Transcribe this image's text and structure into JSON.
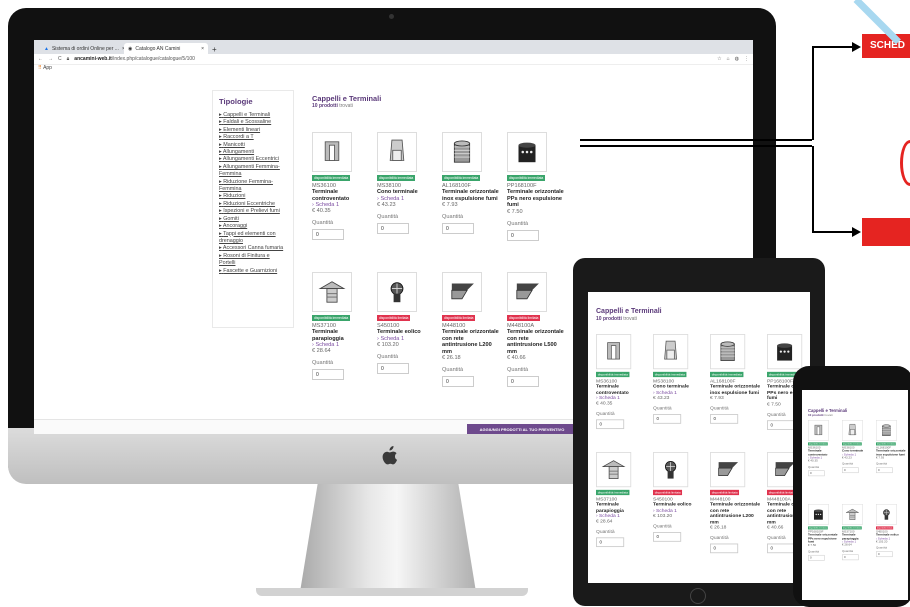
{
  "browser": {
    "tabs": [
      {
        "label": "Sistema di ordini Online per ...",
        "active": false
      },
      {
        "label": "Catalogo AN Camini",
        "active": true
      }
    ],
    "new_tab": "+",
    "url_host": "ancamini-web.it",
    "url_path": "/index.php/catalogue/catalogue/5/100",
    "bookmarks_label": "App"
  },
  "sidebar": {
    "title": "Tipologie",
    "items": [
      "Cappelli e Terminali",
      "Faldali e Scossaline",
      "Elementi lineari",
      "Raccordi a T",
      "Manicotti",
      "Allungamenti",
      "Allungamenti Eccentrici",
      "Allungamenti Femmina-Femmina",
      "Riduzione Femmina-Femmina",
      "Riduzioni",
      "Riduzioni Eccentriche",
      "Ispezioni e Prelievi fumi",
      "Gomiti",
      "Ancoraggi",
      "Tappi ed elementi con drenaggio",
      "Accessori Canna fumaria",
      "Rosoni di Finitura e Portelli",
      "Fascette e Guarnizioni"
    ]
  },
  "main": {
    "title": "Cappelli e Terminali",
    "count": "10 prodotti",
    "count_suffix": "trovati",
    "quantity_label": "Quantità",
    "cta": "AGGIUNGI PRODOTTI AL TUO PREVENTIVO"
  },
  "products": [
    {
      "badge": "disponibilità immediata",
      "badge_color": "#3aa56b",
      "code": "MS36100",
      "name": "Terminale controventato",
      "link": "Scheda 1",
      "price": "€ 40.35",
      "qty": "0"
    },
    {
      "badge": "disponibilità immediata",
      "badge_color": "#3aa56b",
      "code": "MS38100",
      "name": "Cono terminale",
      "link": "Scheda 1",
      "price": "€ 43.23",
      "qty": "0"
    },
    {
      "badge": "disponibilità immediata",
      "badge_color": "#3aa56b",
      "code": "AL168100F",
      "name": "Terminale orizzontale inox espulsione fumi",
      "link": "",
      "price": "€ 7.93",
      "qty": "0"
    },
    {
      "badge": "disponibilità immediata",
      "badge_color": "#3aa56b",
      "code": "PP168100F",
      "name": "Terminale orizzontale PPs nero espulsione fumi",
      "link": "",
      "price": "€ 7.50",
      "qty": "0"
    },
    {
      "badge": "disponibilità immediata",
      "badge_color": "#3aa56b",
      "code": "MS37100",
      "name": "Terminale parapioggia",
      "link": "Scheda 1",
      "price": "€ 28.64",
      "qty": "0"
    },
    {
      "badge": "disponibilità limitata",
      "badge_color": "#e0334e",
      "code": "S450100",
      "name": "Terminale eolico",
      "link": "Scheda 1",
      "price": "€ 103.20",
      "qty": "0"
    },
    {
      "badge": "disponibilità limitata",
      "badge_color": "#e0334e",
      "code": "M448100",
      "name": "Terminale orizzontale con rete antintrusione L200 mm",
      "link": "",
      "price": "€ 26.18",
      "qty": "0"
    },
    {
      "badge": "disponibilità limitata",
      "badge_color": "#e0334e",
      "code": "M448100A",
      "name": "Terminale orizzontale con rete antintrusione L500 mm",
      "link": "",
      "price": "€ 40.66",
      "qty": "0"
    }
  ],
  "callout": {
    "label": "SCHED",
    "color": "#e52421"
  },
  "icons": {
    "link_arrow": "›",
    "bullet": "▸"
  }
}
